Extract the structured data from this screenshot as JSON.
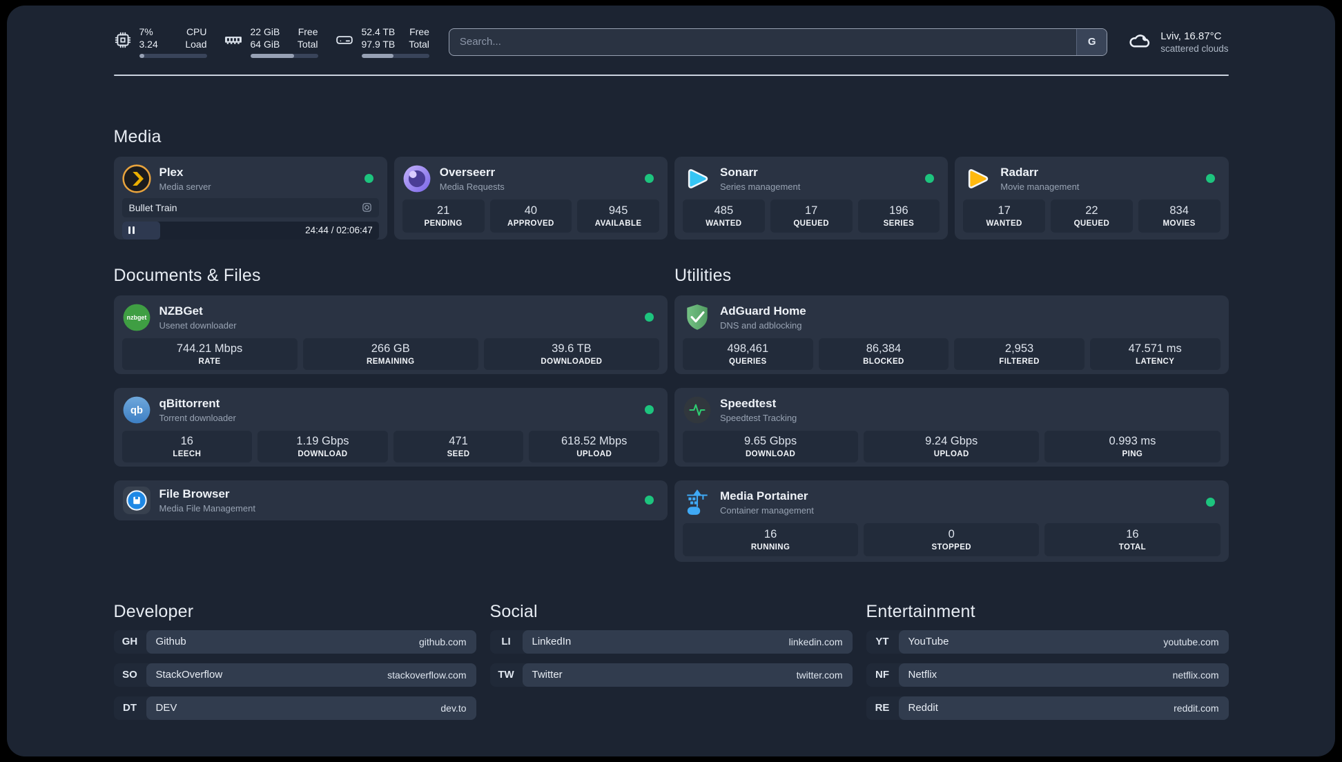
{
  "colors": {
    "status_online": "#1dc47e",
    "page_bg": "#1c2432",
    "card_bg": "#2a3343",
    "tile_bg": "#222b3a"
  },
  "header": {
    "stats": [
      {
        "icon": "cpu-icon",
        "col1": [
          "7%",
          "3.24"
        ],
        "col2": [
          "CPU",
          "Load"
        ],
        "progress": 8
      },
      {
        "icon": "ram-icon",
        "col1": [
          "22 GiB",
          "64 GiB"
        ],
        "col2": [
          "Free",
          "Total"
        ],
        "progress": 65
      },
      {
        "icon": "disk-icon",
        "col1": [
          "52.4 TB",
          "97.9 TB"
        ],
        "col2": [
          "Free",
          "Total"
        ],
        "progress": 47
      }
    ],
    "search": {
      "placeholder": "Search...",
      "engine": "G"
    },
    "weather": {
      "location": "Lviv, 16.87°C",
      "condition": "scattered clouds"
    }
  },
  "media": {
    "title": "Media",
    "plex": {
      "name": "Plex",
      "desc": "Media server",
      "now_playing": "Bullet Train",
      "time": "24:44 / 02:06:47",
      "progress": 15
    },
    "overseerr": {
      "name": "Overseerr",
      "desc": "Media Requests",
      "stats": [
        {
          "value": "21",
          "label": "PENDING"
        },
        {
          "value": "40",
          "label": "APPROVED"
        },
        {
          "value": "945",
          "label": "AVAILABLE"
        }
      ]
    },
    "sonarr": {
      "name": "Sonarr",
      "desc": "Series management",
      "stats": [
        {
          "value": "485",
          "label": "WANTED"
        },
        {
          "value": "17",
          "label": "QUEUED"
        },
        {
          "value": "196",
          "label": "SERIES"
        }
      ]
    },
    "radarr": {
      "name": "Radarr",
      "desc": "Movie management",
      "stats": [
        {
          "value": "17",
          "label": "WANTED"
        },
        {
          "value": "22",
          "label": "QUEUED"
        },
        {
          "value": "834",
          "label": "MOVIES"
        }
      ]
    }
  },
  "documents": {
    "title": "Documents & Files",
    "nzbget": {
      "name": "NZBGet",
      "desc": "Usenet downloader",
      "stats": [
        {
          "value": "744.21 Mbps",
          "label": "RATE"
        },
        {
          "value": "266 GB",
          "label": "REMAINING"
        },
        {
          "value": "39.6 TB",
          "label": "DOWNLOADED"
        }
      ]
    },
    "qbittorrent": {
      "name": "qBittorrent",
      "desc": "Torrent downloader",
      "stats": [
        {
          "value": "16",
          "label": "LEECH"
        },
        {
          "value": "1.19 Gbps",
          "label": "DOWNLOAD"
        },
        {
          "value": "471",
          "label": "SEED"
        },
        {
          "value": "618.52 Mbps",
          "label": "UPLOAD"
        }
      ]
    },
    "filebrowser": {
      "name": "File Browser",
      "desc": "Media File Management"
    }
  },
  "utilities": {
    "title": "Utilities",
    "adguard": {
      "name": "AdGuard Home",
      "desc": "DNS and adblocking",
      "stats": [
        {
          "value": "498,461",
          "label": "QUERIES"
        },
        {
          "value": "86,384",
          "label": "BLOCKED"
        },
        {
          "value": "2,953",
          "label": "FILTERED"
        },
        {
          "value": "47.571 ms",
          "label": "LATENCY"
        }
      ]
    },
    "speedtest": {
      "name": "Speedtest",
      "desc": "Speedtest Tracking",
      "stats": [
        {
          "value": "9.65 Gbps",
          "label": "DOWNLOAD"
        },
        {
          "value": "9.24 Gbps",
          "label": "UPLOAD"
        },
        {
          "value": "0.993 ms",
          "label": "PING"
        }
      ]
    },
    "portainer": {
      "name": "Media Portainer",
      "desc": "Container management",
      "stats": [
        {
          "value": "16",
          "label": "RUNNING"
        },
        {
          "value": "0",
          "label": "STOPPED"
        },
        {
          "value": "16",
          "label": "TOTAL"
        }
      ]
    }
  },
  "links": {
    "developer": {
      "title": "Developer",
      "items": [
        {
          "abbr": "GH",
          "label": "Github",
          "url": "github.com"
        },
        {
          "abbr": "SO",
          "label": "StackOverflow",
          "url": "stackoverflow.com"
        },
        {
          "abbr": "DT",
          "label": "DEV",
          "url": "dev.to"
        }
      ]
    },
    "social": {
      "title": "Social",
      "items": [
        {
          "abbr": "LI",
          "label": "LinkedIn",
          "url": "linkedin.com"
        },
        {
          "abbr": "TW",
          "label": "Twitter",
          "url": "twitter.com"
        }
      ]
    },
    "entertainment": {
      "title": "Entertainment",
      "items": [
        {
          "abbr": "YT",
          "label": "YouTube",
          "url": "youtube.com"
        },
        {
          "abbr": "NF",
          "label": "Netflix",
          "url": "netflix.com"
        },
        {
          "abbr": "RE",
          "label": "Reddit",
          "url": "reddit.com"
        }
      ]
    }
  }
}
